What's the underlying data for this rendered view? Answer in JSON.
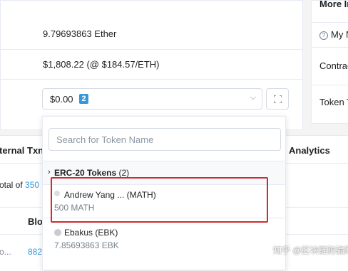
{
  "overview": {
    "balance": "9.79693863 Ether",
    "value": "$1,808.22 (@ $184.57/ETH)",
    "token_button": {
      "value": "$0.00",
      "badge": "2"
    }
  },
  "right_panel": {
    "more_info": "More In",
    "my_name": "My N",
    "contract": "Contrac",
    "token_tracker": "Token T"
  },
  "tabs": {
    "internal_txns": "ternal Txn",
    "analytics": "Analytics",
    "total_prefix": "otal of ",
    "total_count": "350",
    "col_block": "Blo",
    "row_txn": "o...",
    "row_block": "882"
  },
  "dropdown": {
    "search_placeholder": "Search for Token Name",
    "group": {
      "title": "ERC-20 Tokens",
      "count": "(2)"
    },
    "tokens": [
      {
        "name": "Andrew Yang ... (MATH)",
        "amount": "500 MATH"
      },
      {
        "name": "Ebakus (EBK)",
        "amount": "7.85693863 EBK"
      }
    ]
  },
  "watermark": "知乎 @区块链防骗网",
  "colors": {
    "accent": "#3498db",
    "highlight": "#d02b2b"
  }
}
